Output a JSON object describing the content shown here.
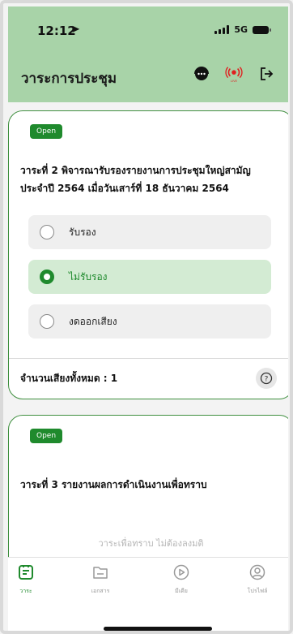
{
  "status_bar": {
    "time": "12:12",
    "network": "5G"
  },
  "header": {
    "title": "วาระการประชุม",
    "live_label": "LIVE"
  },
  "cards": [
    {
      "badge": "Open",
      "question": "วาระที่ 2 พิจารณารับรองรายงานการประชุมใหญ่สามัญประจำปี 2564 เมื่อวันเสาร์ที่ 18 ธันวาคม 2564",
      "options": [
        {
          "label": "รับรอง",
          "selected": false
        },
        {
          "label": "ไม่รับรอง",
          "selected": true
        },
        {
          "label": "งดออกเสียง",
          "selected": false
        }
      ],
      "vote_count": "จำนวนเสียงทั้งหมด : 1"
    },
    {
      "badge": "Open",
      "question": "วาระที่ 3 รายงานผลการดำเนินงานเพื่อทราบ",
      "note": "วาระเพื่อทราบ ไม่ต้องลงมติ"
    }
  ],
  "tabs": [
    {
      "label": "วาระ",
      "icon": "agenda-icon",
      "active": true
    },
    {
      "label": "เอกสาร",
      "icon": "folder-icon",
      "active": false
    },
    {
      "label": "มีเดีย",
      "icon": "play-icon",
      "active": false
    },
    {
      "label": "โปรไฟล์",
      "icon": "profile-icon",
      "active": false
    }
  ],
  "colors": {
    "header_bg": "#a8d3a8",
    "accent": "#1f8a2d",
    "live_red": "#e02020"
  }
}
